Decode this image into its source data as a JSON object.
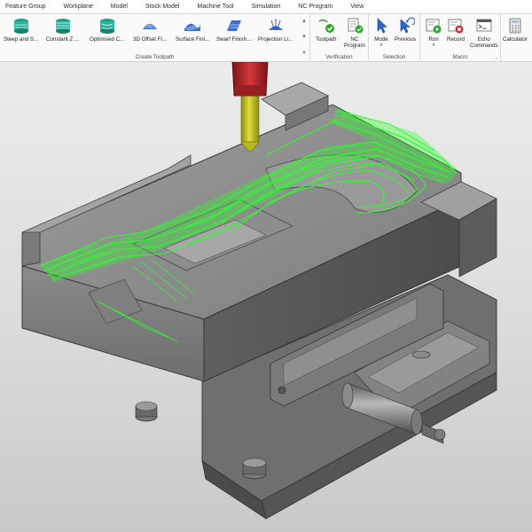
{
  "tabs": [
    "Feature Group",
    "Workplane",
    "Model",
    "Stock Model",
    "Machine Tool",
    "Simulation",
    "NC Program",
    "View"
  ],
  "groups": {
    "create_toolpath": {
      "label": "Create Toolpath",
      "buttons": [
        "Steep and S...",
        "Constant Z ...",
        "Optimised C...",
        "3D Offset Fi...",
        "Surface Fini...",
        "Swarf Finish...",
        "Projection Li..."
      ]
    },
    "verification": {
      "label": "Verification",
      "toolpath": "Toolpath",
      "nc_program_1": "NC",
      "nc_program_2": "Program"
    },
    "selection": {
      "label": "Selection",
      "mode": "Mode",
      "previous": "Previous"
    },
    "macro": {
      "label": "Macro",
      "run": "Run",
      "record": "Record",
      "echo_1": "Echo",
      "echo_2": "Commands"
    },
    "utility": {
      "calculator": "Calculator"
    }
  },
  "colors": {
    "toolpath_green": "#2bff2b",
    "tool_holder_red": "#c0282a",
    "tool_shank_yellow": "#c8c820",
    "fixture_gray": "#8e8e8e"
  }
}
